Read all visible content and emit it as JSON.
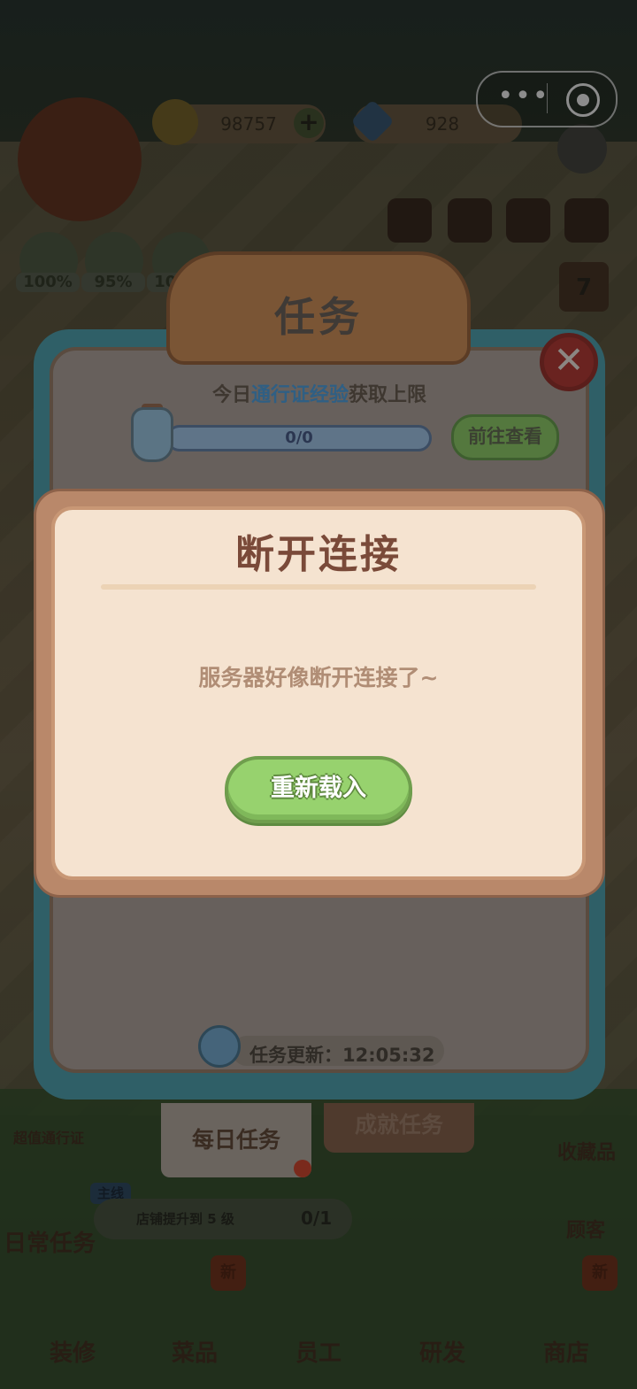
{
  "top_hud": {
    "coins": "98757",
    "gems": "928",
    "stats": [
      "100%",
      "95%",
      "100%"
    ],
    "calendar_day": "7"
  },
  "mission_panel": {
    "title": "任务",
    "pass_prefix": "今日",
    "pass_highlight": "通行证经验",
    "pass_suffix": "获取上限",
    "progress": "0/0",
    "goto_label": "前往查看",
    "refresh_label": "任务更新：",
    "refresh_time": "12:05:32",
    "tabs": [
      "每日任务",
      "成就任务"
    ]
  },
  "bottom_hud": {
    "pass_label": "超值通行证",
    "daily_label": "日常任务",
    "main_tag": "主线",
    "quest_text": "店铺提升到 5 级",
    "quest_count": "0/1",
    "collection_label": "收藏品",
    "customer_label": "顾客",
    "new_badge": "新",
    "nav": [
      "装修",
      "菜品",
      "员工",
      "研发",
      "商店"
    ]
  },
  "dialog": {
    "title": "断开连接",
    "message": "服务器好像断开连接了~",
    "reload_label": "重新载入"
  },
  "colors": {
    "dialog_bg": "#f5e3d0",
    "dialog_frame": "#b9886a",
    "reload_button": "#97d26e",
    "title_text": "#7a4a39"
  }
}
